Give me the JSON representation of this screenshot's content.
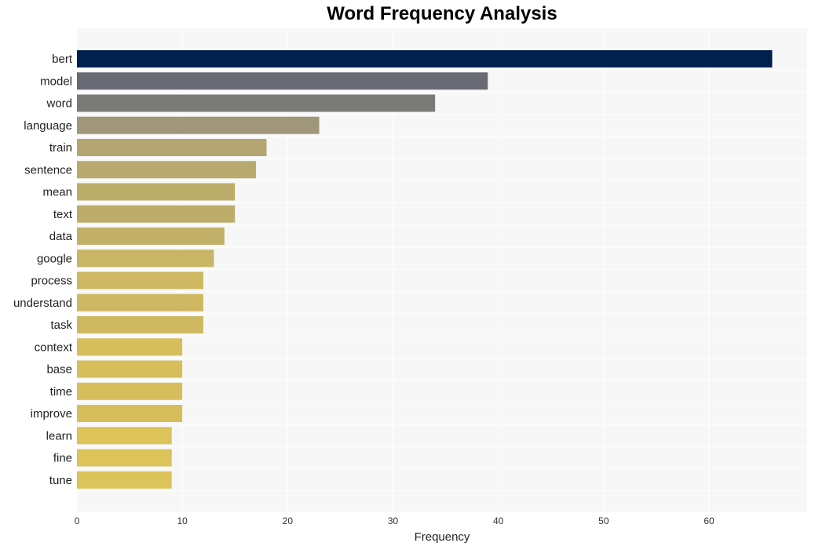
{
  "chart_data": {
    "type": "bar",
    "orientation": "horizontal",
    "title": "Word Frequency Analysis",
    "xlabel": "Frequency",
    "ylabel": "",
    "xlim": [
      0,
      69
    ],
    "xticks": [
      0,
      10,
      20,
      30,
      40,
      50,
      60
    ],
    "grid": true,
    "categories": [
      "bert",
      "model",
      "word",
      "language",
      "train",
      "sentence",
      "mean",
      "text",
      "data",
      "google",
      "process",
      "understand",
      "task",
      "context",
      "base",
      "time",
      "improve",
      "learn",
      "fine",
      "tune"
    ],
    "values": [
      66,
      39,
      34,
      23,
      18,
      17,
      15,
      15,
      14,
      13,
      12,
      12,
      12,
      10,
      10,
      10,
      10,
      9,
      9,
      9
    ],
    "colors": [
      "#00214d",
      "#686b73",
      "#7a7a78",
      "#a0967a",
      "#b3a672",
      "#b8aa6e",
      "#bdad6a",
      "#bdad6a",
      "#c2b068",
      "#c8b565",
      "#ceb962",
      "#ceb962",
      "#ceb962",
      "#d6be5c",
      "#d6be5c",
      "#d6be5c",
      "#d6be5c",
      "#dcc35a",
      "#dcc35a",
      "#dcc35a"
    ],
    "plot_background": "#f7f7f7"
  }
}
